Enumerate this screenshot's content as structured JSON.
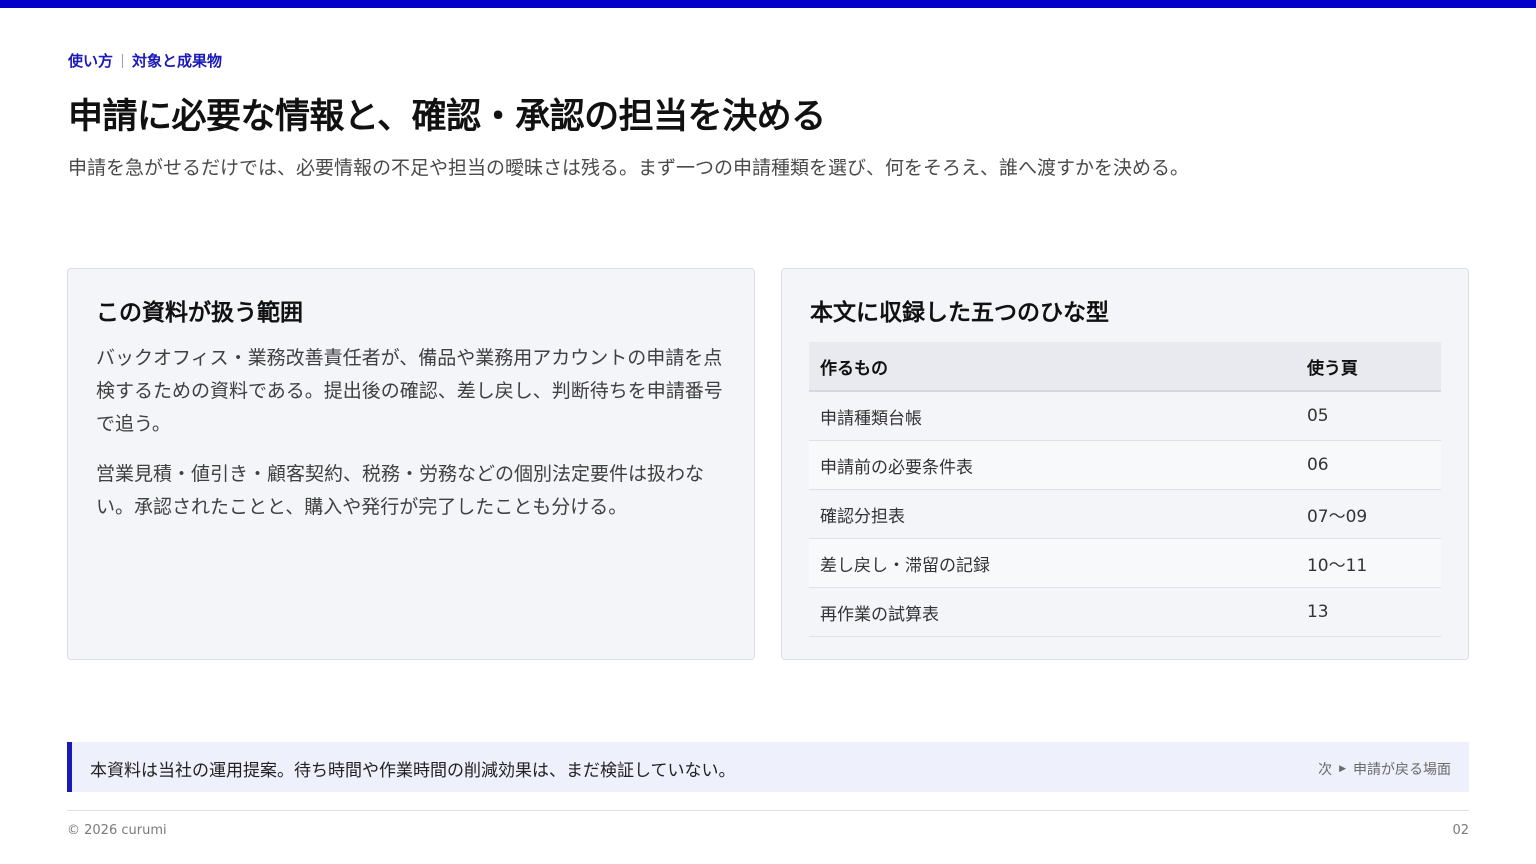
{
  "eyebrow": {
    "section": "使い方",
    "topic": "対象と成果物"
  },
  "page_title": "申請に必要な情報と、確認・承認の担当を決める",
  "lead": "申請を急がせるだけでは、必要情報の不足や担当の曖昧さは残る。まず一つの申請種類を選び、何をそろえ、誰へ渡すかを決める。",
  "scope_card": {
    "title": "この資料が扱う範囲",
    "paragraphs": [
      "バックオフィス・業務改善責任者が、備品や業務用アカウントの申請を点検するための資料である。提出後の確認、差し戻し、判断待ちを申請番号で追う。",
      "営業見積・値引き・顧客契約、税務・労務などの個別法定要件は扱わない。承認されたことと、購入や発行が完了したことも分ける。"
    ]
  },
  "templates_card": {
    "title": "本文に収録した五つのひな型",
    "columns": [
      "作るもの",
      "使う頁"
    ],
    "rows": [
      {
        "item": "申請種類台帳",
        "page": "05"
      },
      {
        "item": "申請前の必要条件表",
        "page": "06"
      },
      {
        "item": "確認分担表",
        "page": "07〜09"
      },
      {
        "item": "差し戻し・滞留の記録",
        "page": "10〜11"
      },
      {
        "item": "再作業の試算表",
        "page": "13"
      }
    ]
  },
  "note": {
    "text": "本資料は当社の運用提案。待ち時間や作業時間の削減効果は、まだ検証していない。",
    "next_label": "次",
    "next_title": "申請が戻る場面"
  },
  "footer": {
    "copyright": "© 2026 curumi",
    "page_number": "02"
  },
  "colors": {
    "accent": "#0000c8",
    "card_background": "#f4f5f9",
    "note_background": "#eef0fb"
  }
}
